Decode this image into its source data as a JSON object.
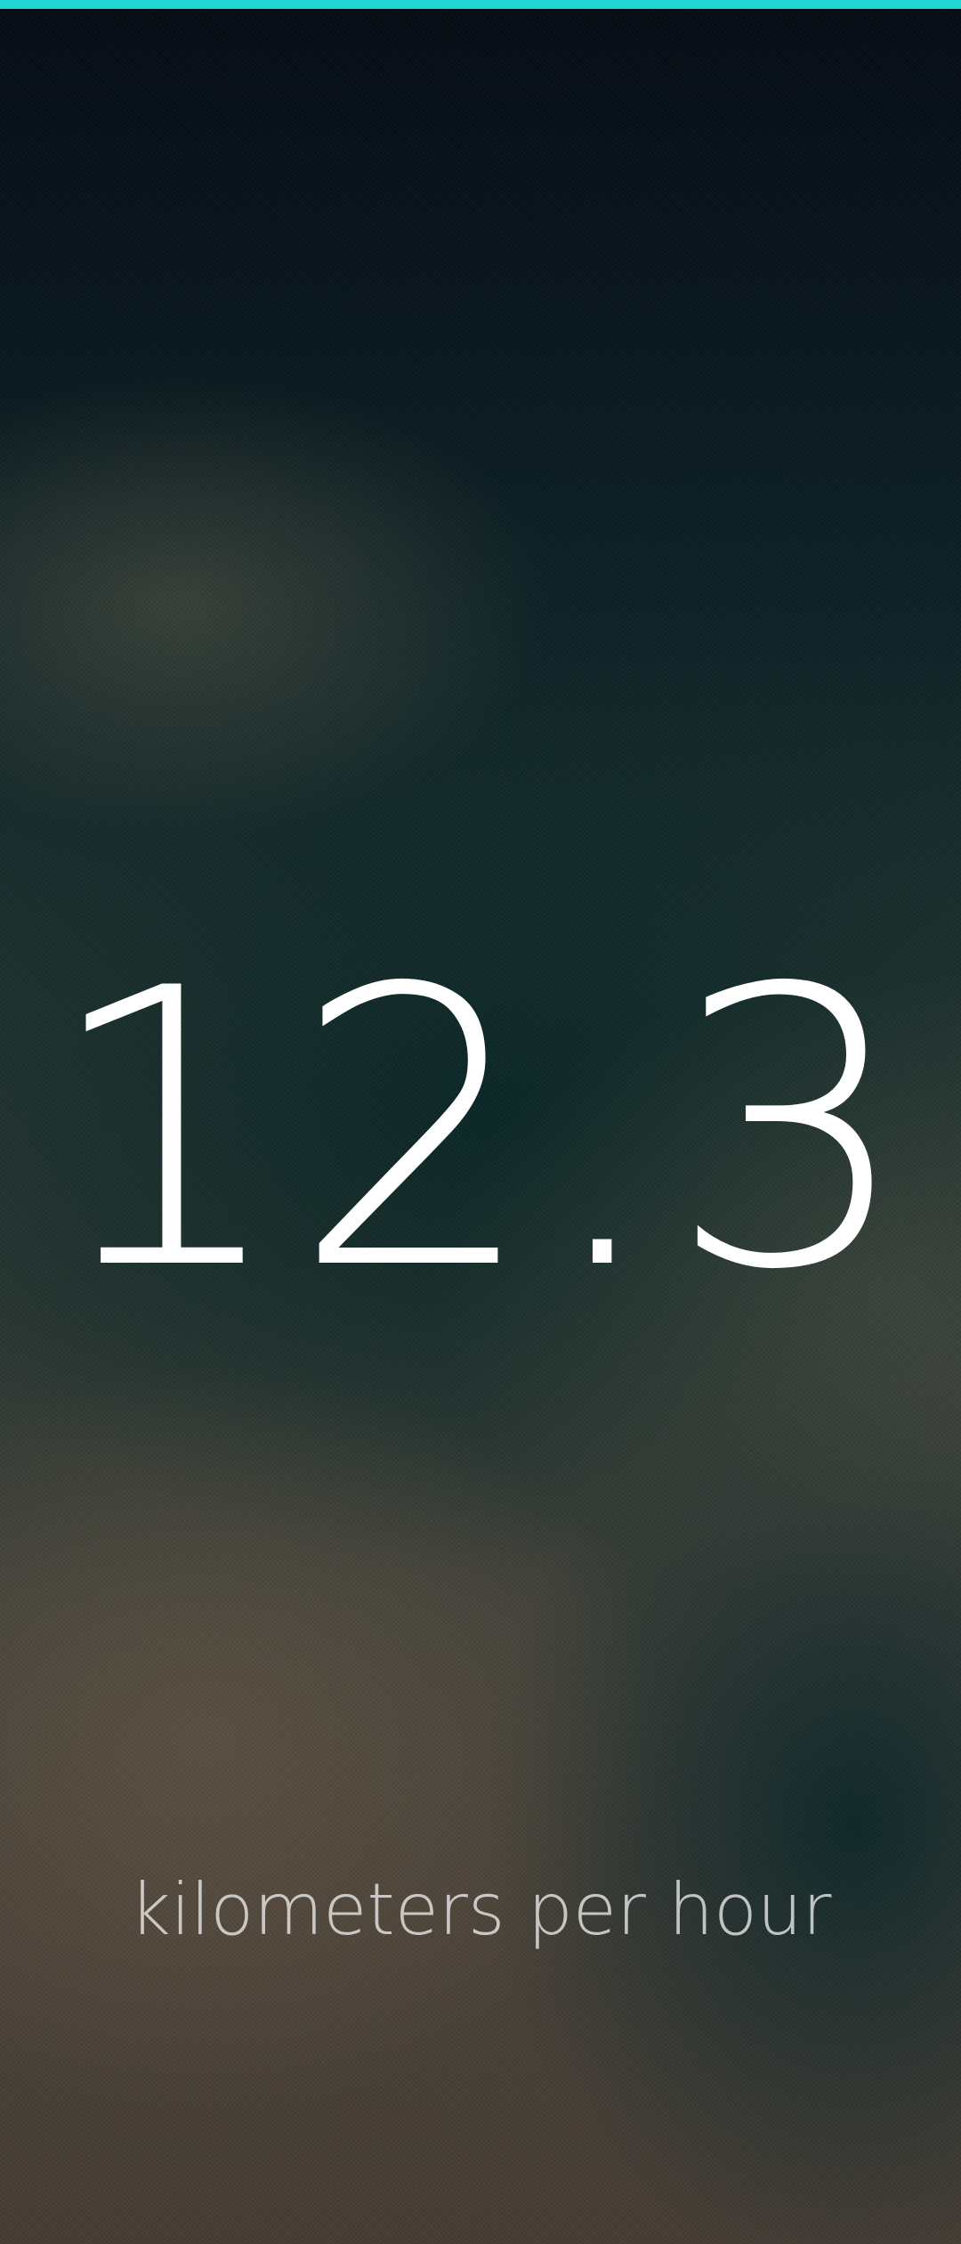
{
  "accent_color": "#1fd6d3",
  "speed": {
    "value": "12.3",
    "unit": "kilometers per hour"
  }
}
